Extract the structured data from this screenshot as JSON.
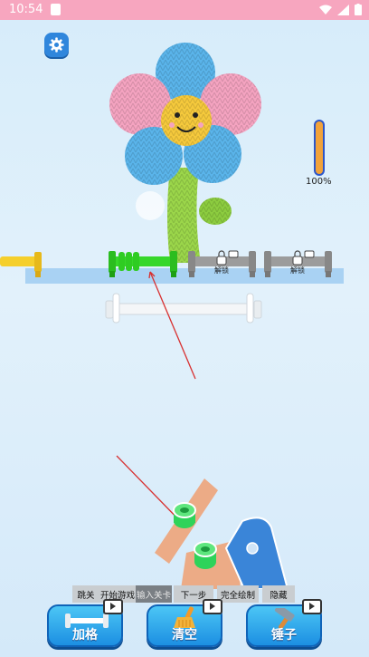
{
  "status_bar": {
    "time": "10:54",
    "battery_icon": "battery-icon",
    "wifi_icon": "wifi-icon",
    "signal_icon": "signal-icon"
  },
  "settings": {
    "icon": "gear-icon"
  },
  "progress": {
    "value": 1.0,
    "label": "100%"
  },
  "slots": {
    "lock_label_1": "解锁",
    "lock_label_2": "解锁"
  },
  "debug_buttons": [
    {
      "label": "跳关"
    },
    {
      "label": "开始游戏"
    },
    {
      "label": "输入关卡"
    },
    {
      "label": "下一步"
    },
    {
      "label": "完全绘制"
    },
    {
      "label": "隐藏"
    }
  ],
  "tools": [
    {
      "label": "加格",
      "icon": "rack-icon"
    },
    {
      "label": "清空",
      "icon": "broom-icon"
    },
    {
      "label": "锤子",
      "icon": "hammer-icon"
    }
  ],
  "colors": {
    "pink": "#f4a3c0",
    "blue": "#5ab4ea",
    "yellow": "#f5c93c",
    "green": "#9bd64a",
    "orange": "#f2a23a",
    "salmon": "#ecab86"
  }
}
